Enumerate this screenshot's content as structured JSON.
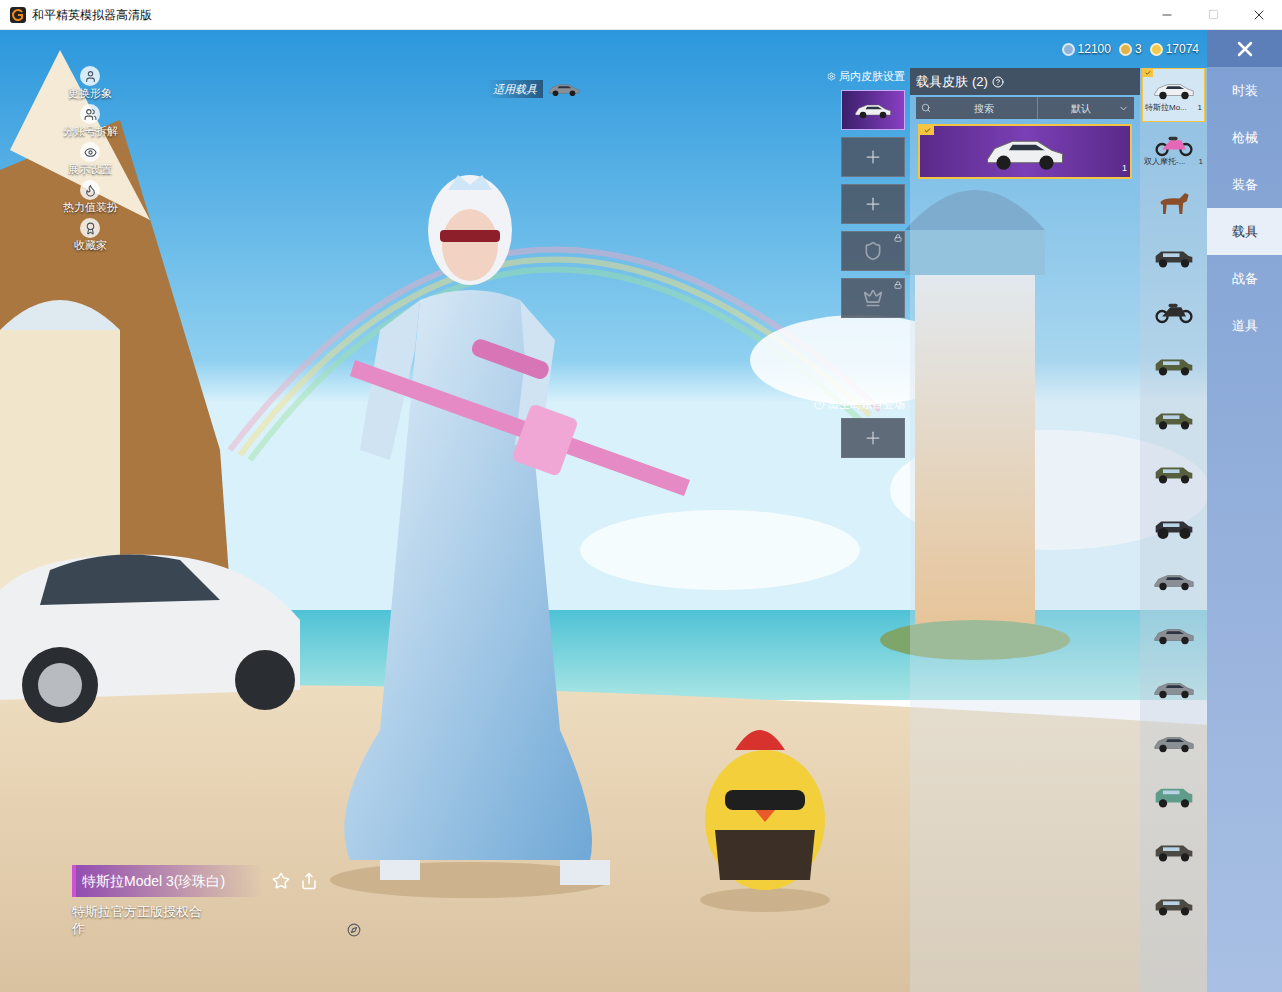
{
  "window": {
    "title": "和平精英模拟器高清版"
  },
  "side_menu": [
    {
      "label": "更换形象"
    },
    {
      "label": "分账号拆解"
    },
    {
      "label": "展示设置"
    },
    {
      "label": "热力值装扮"
    },
    {
      "label": "收藏家"
    }
  ],
  "vehicle_badge": {
    "label": "适用载具"
  },
  "currencies": [
    {
      "amount": "12100",
      "color": "#8fb3d9"
    },
    {
      "amount": "3",
      "color": "#e0b24a"
    },
    {
      "amount": "17074",
      "color": "#f2c94c"
    }
  ],
  "slots": {
    "title": "局内皮肤设置",
    "items": [
      {
        "kind": "vehicle",
        "selected": true,
        "locked": false
      },
      {
        "kind": "add",
        "selected": false,
        "locked": false
      },
      {
        "kind": "add",
        "selected": false,
        "locked": false
      },
      {
        "kind": "emblem",
        "selected": false,
        "locked": true
      },
      {
        "kind": "crown",
        "selected": false,
        "locked": true
      }
    ]
  },
  "intro": {
    "title": "出生岛炫目登场",
    "slot": {
      "kind": "add",
      "selected": false,
      "locked": false
    }
  },
  "skin_panel": {
    "title": "载具皮肤",
    "count": "(2)",
    "search_placeholder": "搜索",
    "sort": "默认",
    "skins": [
      {
        "selected": true,
        "equipped": true,
        "quantity": "1"
      }
    ]
  },
  "vehicles": [
    {
      "kind": "sedan",
      "label": "特斯拉Mo...",
      "count": "1",
      "selected": true
    },
    {
      "kind": "motorbike",
      "label": "双人摩托-...",
      "count": "1",
      "selected": false
    },
    {
      "kind": "horse",
      "label": "",
      "count": "",
      "selected": false
    },
    {
      "kind": "buggy",
      "label": "",
      "count": "",
      "selected": false
    },
    {
      "kind": "motorcycle",
      "label": "",
      "count": "",
      "selected": false
    },
    {
      "kind": "jeep",
      "label": "",
      "count": "",
      "selected": false
    },
    {
      "kind": "jeep",
      "label": "",
      "count": "",
      "selected": false
    },
    {
      "kind": "jeep",
      "label": "",
      "count": "",
      "selected": false
    },
    {
      "kind": "monster-truck",
      "label": "",
      "count": "",
      "selected": false
    },
    {
      "kind": "coupe",
      "label": "",
      "count": "",
      "selected": false
    },
    {
      "kind": "coupe",
      "label": "",
      "count": "",
      "selected": false
    },
    {
      "kind": "coupe",
      "label": "",
      "count": "",
      "selected": false
    },
    {
      "kind": "coupe",
      "label": "",
      "count": "",
      "selected": false
    },
    {
      "kind": "van",
      "label": "",
      "count": "",
      "selected": false
    },
    {
      "kind": "pickup",
      "label": "",
      "count": "",
      "selected": false
    },
    {
      "kind": "pickup",
      "label": "",
      "count": "",
      "selected": false
    }
  ],
  "tabs": [
    {
      "label": "时装",
      "selected": false
    },
    {
      "label": "枪械",
      "selected": false
    },
    {
      "label": "装备",
      "selected": false
    },
    {
      "label": "载具",
      "selected": true
    },
    {
      "label": "战备",
      "selected": false
    },
    {
      "label": "道具",
      "selected": false
    }
  ],
  "selection": {
    "name": "特斯拉Model 3(珍珠白)",
    "note": "特斯拉官方正版授权合作"
  }
}
